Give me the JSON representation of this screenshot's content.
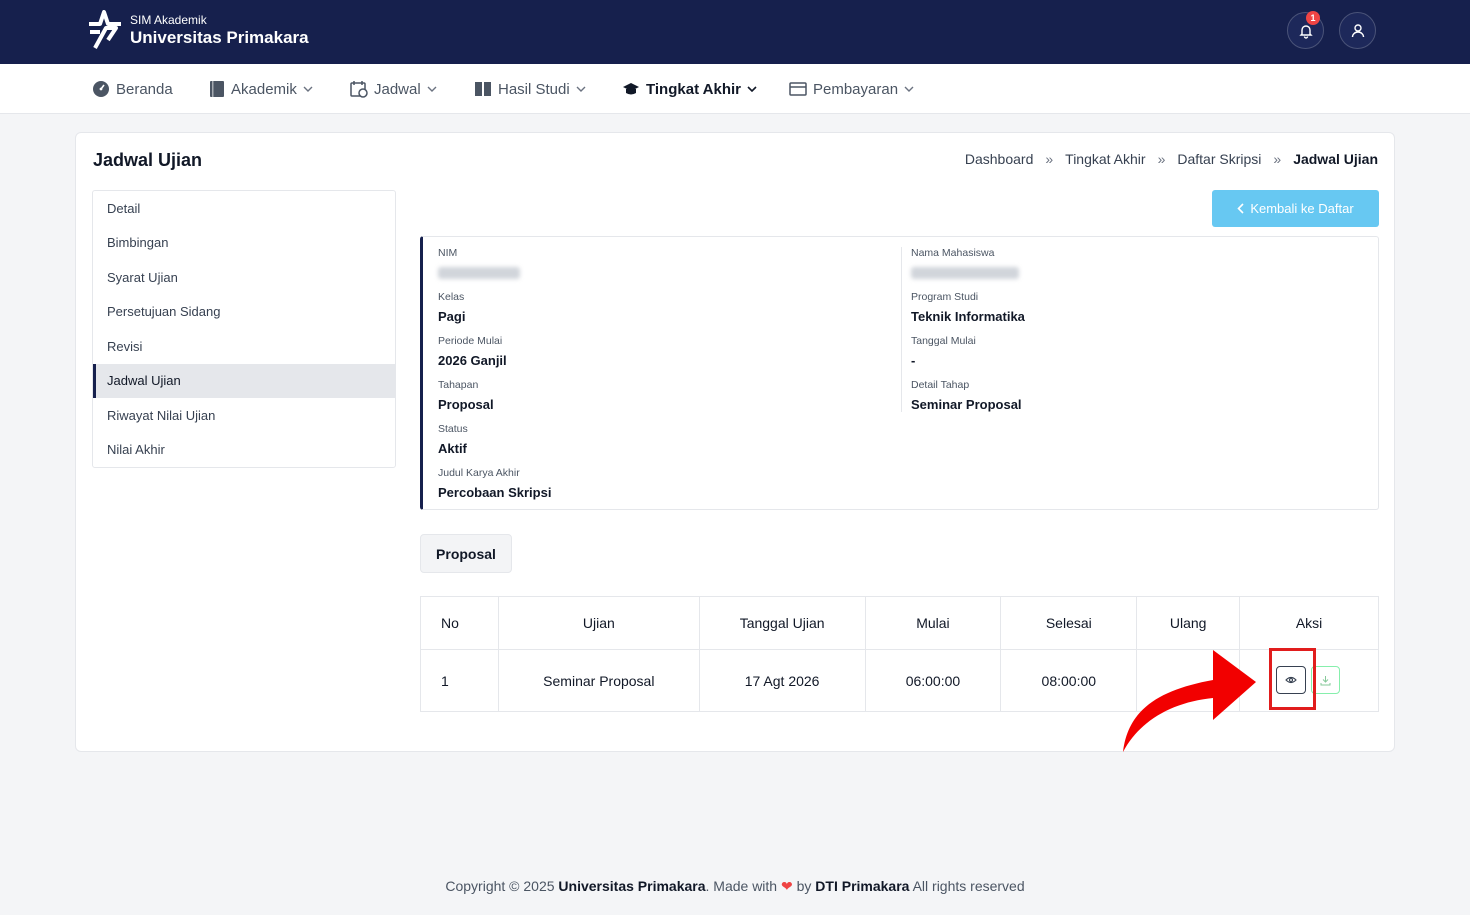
{
  "header": {
    "app_sub": "SIM Akademik",
    "app_title": "Universitas Primakara",
    "notification_count": "1"
  },
  "nav": {
    "items": [
      {
        "label": "Beranda"
      },
      {
        "label": "Akademik"
      },
      {
        "label": "Jadwal"
      },
      {
        "label": "Hasil Studi"
      },
      {
        "label": "Tingkat Akhir"
      },
      {
        "label": "Pembayaran"
      }
    ],
    "active": "Tingkat Akhir"
  },
  "page": {
    "title": "Jadwal Ujian",
    "breadcrumb": [
      "Dashboard",
      "Tingkat Akhir",
      "Daftar Skripsi",
      "Jadwal Ujian"
    ],
    "back_button": "Kembali ke Daftar"
  },
  "sidebar": {
    "items": [
      {
        "label": "Detail"
      },
      {
        "label": "Bimbingan"
      },
      {
        "label": "Syarat Ujian"
      },
      {
        "label": "Persetujuan Sidang"
      },
      {
        "label": "Revisi"
      },
      {
        "label": "Jadwal Ujian"
      },
      {
        "label": "Riwayat Nilai Ujian"
      },
      {
        "label": "Nilai Akhir"
      }
    ],
    "active": "Jadwal Ujian"
  },
  "info": {
    "nim_label": "NIM",
    "nama_label": "Nama Mahasiswa",
    "kelas_label": "Kelas",
    "kelas": "Pagi",
    "prodi_label": "Program Studi",
    "prodi": "Teknik Informatika",
    "periode_label": "Periode Mulai",
    "periode": "2026 Ganjil",
    "tanggal_mulai_label": "Tanggal Mulai",
    "tanggal_mulai": "-",
    "tahapan_label": "Tahapan",
    "tahapan": "Proposal",
    "detail_tahap_label": "Detail Tahap",
    "detail_tahap": "Seminar Proposal",
    "status_label": "Status",
    "status": "Aktif",
    "judul_label": "Judul Karya Akhir",
    "judul": "Percobaan Skripsi"
  },
  "tab": {
    "label": "Proposal"
  },
  "table": {
    "headers": [
      "No",
      "Ujian",
      "Tanggal Ujian",
      "Mulai",
      "Selesai",
      "Ulang",
      "Aksi"
    ],
    "rows": [
      {
        "no": "1",
        "ujian": "Seminar Proposal",
        "tanggal": "17 Agt 2026",
        "mulai": "06:00:00",
        "selesai": "08:00:00",
        "ulang": ""
      }
    ]
  },
  "footer": {
    "prefix": "Copyright © 2025 ",
    "org": "Universitas Primakara",
    "made_with": ". Made with ",
    "by": " by ",
    "dev": "DTI Primakara",
    "suffix": " All rights reserved"
  },
  "colors": {
    "header_bg": "#16204d",
    "back_button": "#67c8f2",
    "highlight": "#e11d1d"
  }
}
